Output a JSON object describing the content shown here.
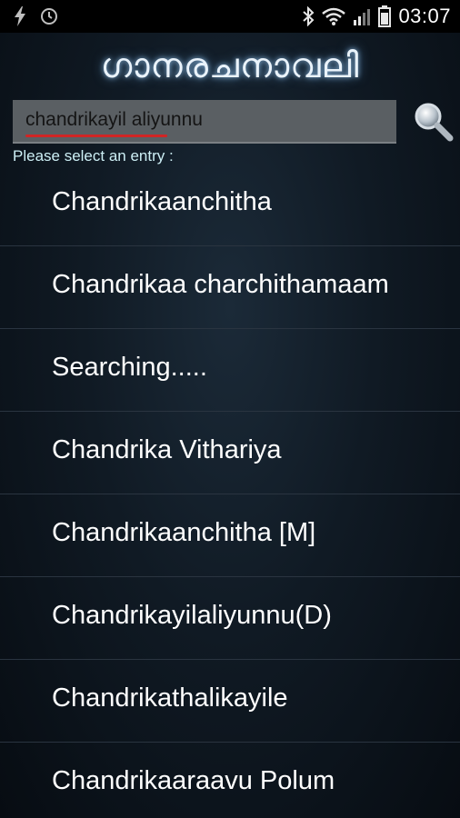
{
  "status_bar": {
    "time": "03:07",
    "icons": [
      "flash-icon",
      "alarm-icon",
      "bluetooth-icon",
      "wifi-icon",
      "signal-icon",
      "battery-icon"
    ]
  },
  "app": {
    "logo_text": "ഗാനരചനാവലി",
    "search": {
      "value": "chandrikayil aliyunnu",
      "icon": "search-icon"
    },
    "prompt": "Please select an entry :",
    "entries": [
      "Chandrikaanchitha",
      "Chandrikaa charchithamaam",
      "Searching.....",
      "Chandrika Vithariya",
      "Chandrikaanchitha [M]",
      "Chandrikayilaliyunnu(D)",
      "Chandrikathalikayile",
      "Chandrikaaraavu Polum"
    ]
  },
  "colors": {
    "background": "#0b141d",
    "prompt_text": "#cdeff5",
    "search_field": "#5a5f63",
    "spellcheck_underline": "#d02525"
  }
}
